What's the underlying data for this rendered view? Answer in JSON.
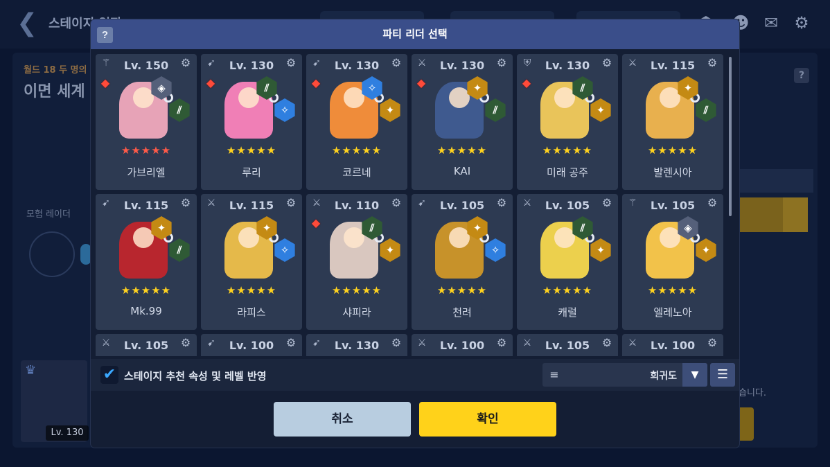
{
  "background": {
    "title": "스테이지 입장",
    "world_subtitle": "월드 18 두 명의",
    "stage_name": "이면 세계",
    "radar_label": "모험 레이더",
    "right_note": "습니다.",
    "avatar_level": "Lv. 130"
  },
  "modal": {
    "help_label": "?",
    "title": "파티 리더 선택"
  },
  "heroes": [
    {
      "level": "Lv. 150",
      "name": "가브리엘",
      "role": "support",
      "stars": "★★★★★",
      "star_color": "red",
      "elem_badge": true,
      "sprite_color": "#e7a3b7",
      "chain_top": "gray",
      "chain_bottom": "green"
    },
    {
      "level": "Lv. 130",
      "name": "루리",
      "role": "ranged",
      "stars": "★★★★★",
      "star_color": "gold",
      "elem_badge": true,
      "sprite_color": "#f07fb6",
      "chain_top": "green",
      "chain_bottom": "blue"
    },
    {
      "level": "Lv. 130",
      "name": "코르네",
      "role": "ranged",
      "stars": "★★★★★",
      "star_color": "gold",
      "elem_badge": true,
      "sprite_color": "#ef8c3a",
      "chain_top": "blue",
      "chain_bottom": "gold"
    },
    {
      "level": "Lv. 130",
      "name": "KAI",
      "role": "warrior",
      "stars": "★★★★★",
      "star_color": "gold",
      "elem_badge": true,
      "sprite_color": "#3f5a8f",
      "chain_top": "gold",
      "chain_bottom": "green"
    },
    {
      "level": "Lv. 130",
      "name": "미래 공주",
      "role": "tank",
      "stars": "★★★★★",
      "star_color": "gold",
      "elem_badge": true,
      "sprite_color": "#e9c45a",
      "chain_top": "green",
      "chain_bottom": "gold"
    },
    {
      "level": "Lv. 115",
      "name": "발렌시아",
      "role": "warrior",
      "stars": "★★★★★",
      "star_color": "gold",
      "elem_badge": false,
      "sprite_color": "#e8b04e",
      "chain_top": "gold",
      "chain_bottom": "green"
    },
    {
      "level": "Lv. 115",
      "name": "Mk.99",
      "role": "ranged",
      "stars": "★★★★★",
      "star_color": "gold",
      "elem_badge": false,
      "sprite_color": "#b8262e",
      "chain_top": "gold",
      "chain_bottom": "green"
    },
    {
      "level": "Lv. 115",
      "name": "라피스",
      "role": "warrior",
      "stars": "★★★★★",
      "star_color": "gold",
      "elem_badge": false,
      "sprite_color": "#e5b94a",
      "chain_top": "gold",
      "chain_bottom": "blue"
    },
    {
      "level": "Lv. 110",
      "name": "샤피라",
      "role": "warrior",
      "stars": "★★★★★",
      "star_color": "gold",
      "elem_badge": true,
      "sprite_color": "#d9c7bf",
      "chain_top": "green",
      "chain_bottom": "gold"
    },
    {
      "level": "Lv. 105",
      "name": "천려",
      "role": "ranged",
      "stars": "★★★★★",
      "star_color": "gold",
      "elem_badge": false,
      "sprite_color": "#c7922a",
      "chain_top": "gold",
      "chain_bottom": "blue"
    },
    {
      "level": "Lv. 105",
      "name": "캐럴",
      "role": "warrior",
      "stars": "★★★★★",
      "star_color": "gold",
      "elem_badge": false,
      "sprite_color": "#ecd04d",
      "chain_top": "green",
      "chain_bottom": "gold"
    },
    {
      "level": "Lv. 105",
      "name": "엘레노아",
      "role": "support",
      "stars": "★★★★★",
      "star_color": "gold",
      "elem_badge": false,
      "sprite_color": "#f2c24a",
      "chain_top": "gray",
      "chain_bottom": "gold"
    },
    {
      "level": "Lv. 105",
      "name": "",
      "role": "warrior",
      "stars": "",
      "star_color": "gold",
      "elem_badge": false,
      "sprite_color": "",
      "chain_top": "",
      "chain_bottom": ""
    },
    {
      "level": "Lv. 100",
      "name": "",
      "role": "ranged",
      "stars": "",
      "star_color": "gold",
      "elem_badge": false,
      "sprite_color": "",
      "chain_top": "",
      "chain_bottom": ""
    },
    {
      "level": "Lv. 130",
      "name": "",
      "role": "ranged",
      "stars": "",
      "star_color": "gold",
      "elem_badge": false,
      "sprite_color": "",
      "chain_top": "",
      "chain_bottom": ""
    },
    {
      "level": "Lv. 100",
      "name": "",
      "role": "warrior",
      "stars": "",
      "star_color": "gold",
      "elem_badge": false,
      "sprite_color": "",
      "chain_top": "",
      "chain_bottom": ""
    },
    {
      "level": "Lv. 105",
      "name": "",
      "role": "warrior",
      "stars": "",
      "star_color": "gold",
      "elem_badge": false,
      "sprite_color": "",
      "chain_top": "",
      "chain_bottom": ""
    },
    {
      "level": "Lv. 100",
      "name": "",
      "role": "warrior",
      "stars": "",
      "star_color": "gold",
      "elem_badge": false,
      "sprite_color": "",
      "chain_top": "",
      "chain_bottom": ""
    }
  ],
  "filter": {
    "checkbox_checked": true,
    "checkbox_label": "스테이지 추천 속성 및 레벨 반영",
    "sort_value": "희귀도"
  },
  "buttons": {
    "cancel": "취소",
    "confirm": "확인"
  },
  "icons": {
    "role_support": "⚚",
    "role_ranged": "➹",
    "role_warrior": "⚔",
    "role_tank": "⛨",
    "gear": "⚙",
    "elem": "◆",
    "chain_gold": "✦",
    "chain_green": "⫽",
    "chain_blue": "✧",
    "chain_gray": "◈"
  },
  "colors": {
    "accent_yellow": "#ffd21a",
    "header_blue": "#3a4e8a",
    "card_bg": "#2d3a52"
  }
}
